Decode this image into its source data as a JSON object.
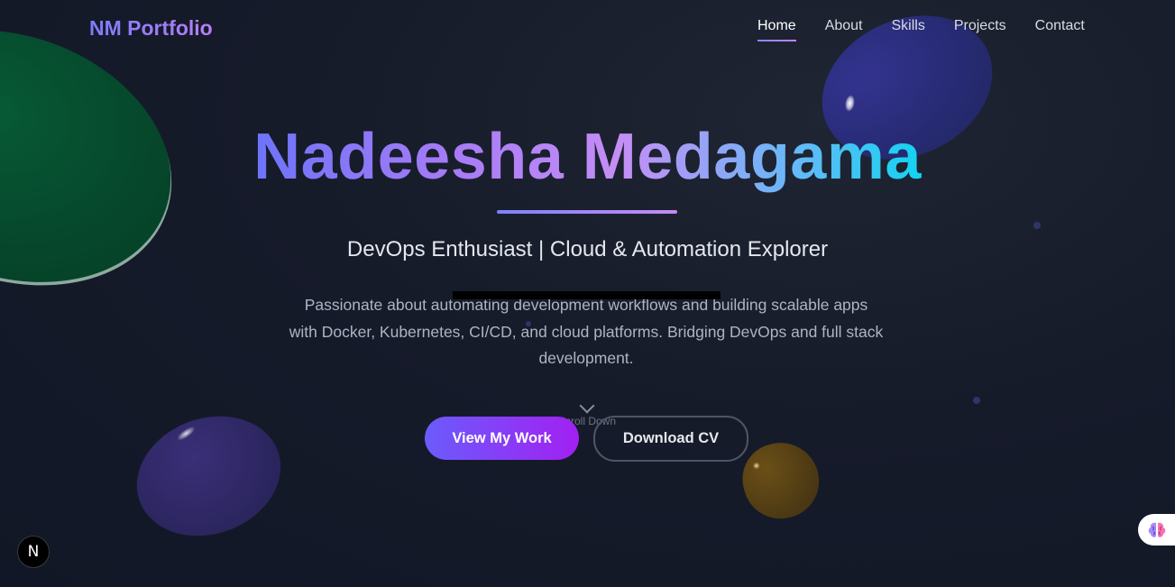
{
  "brand": {
    "name": "NM Portfolio"
  },
  "nav": {
    "items": [
      {
        "label": "Home",
        "active": true
      },
      {
        "label": "About",
        "active": false
      },
      {
        "label": "Skills",
        "active": false
      },
      {
        "label": "Projects",
        "active": false
      },
      {
        "label": "Contact",
        "active": false
      }
    ]
  },
  "hero": {
    "name": "Nadeesha Medagama",
    "tagline": "DevOps Enthusiast | Cloud & Automation Explorer",
    "description": "Passionate about automating development workflows and building scalable apps with Docker, Kubernetes, CI/CD, and cloud platforms. Bridging DevOps and full stack development.",
    "scroll_hint": "Scroll Down",
    "primary_button": "View My Work",
    "secondary_button": "Download CV"
  },
  "widgets": {
    "dev_badge_letter": "N"
  },
  "colors": {
    "background": "#161b2a",
    "accent_start": "#6b5cfb",
    "accent_end": "#a220f2",
    "title_gradient_end": "#13d3f0"
  },
  "icons": {
    "scroll": "chevron-down-icon",
    "dev_badge": "nextjs-logo-icon",
    "assistant": "brain-icon"
  }
}
